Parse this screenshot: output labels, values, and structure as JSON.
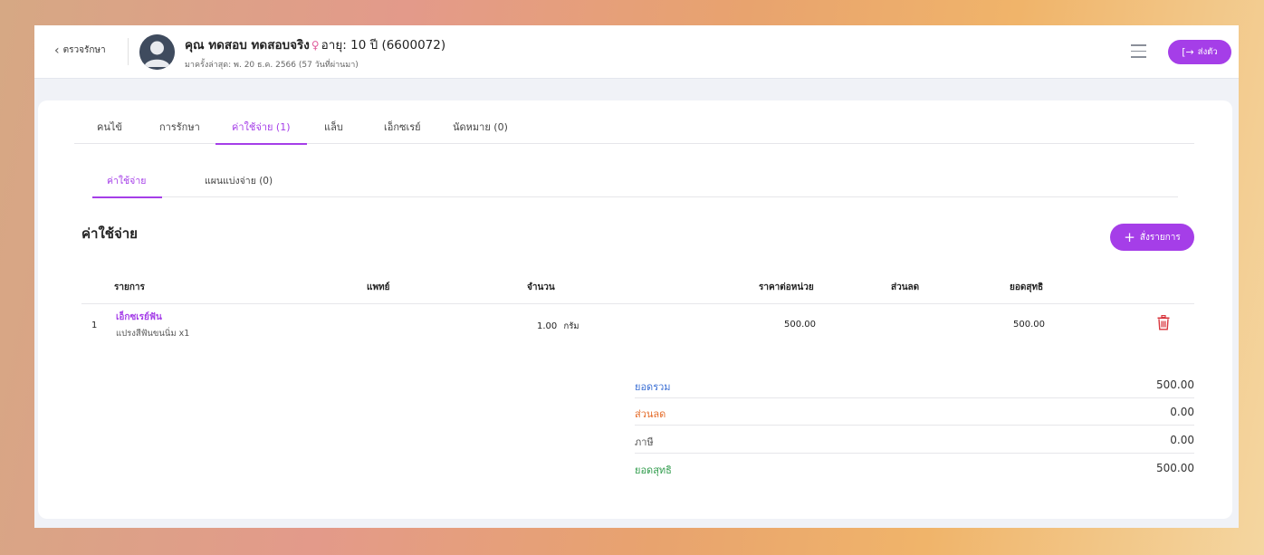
{
  "header": {
    "back_label": "ตรวจรักษา",
    "name": "คุณ ทดสอบ ทดสอบจริง",
    "gender_symbol": "♀",
    "age_text": "อายุ: 10 ปี (6600072)",
    "last_visit": "มาครั้งล่าสุด: พ. 20 ธ.ค. 2566 (57 วันที่ผ่านมา)",
    "checkout_label": "ส่งตัว",
    "checkout_icon": "[→"
  },
  "tabs": [
    {
      "label": "คนไข้"
    },
    {
      "label": "การรักษา"
    },
    {
      "label": "ค่าใช้จ่าย (1)"
    },
    {
      "label": "แล็บ"
    },
    {
      "label": "เอ็กซเรย์"
    },
    {
      "label": "นัดหมาย (0)"
    }
  ],
  "subtabs": [
    {
      "label": "ค่าใช้จ่าย"
    },
    {
      "label": "แผนแบ่งจ่าย (0)"
    }
  ],
  "section": {
    "title": "ค่าใช้จ่าย",
    "order_button": "สั่งรายการ"
  },
  "table": {
    "headers": {
      "item": "รายการ",
      "doctor": "แพทย์",
      "qty": "จำนวน",
      "unit_price": "ราคาต่อหน่วย",
      "discount": "ส่วนลด",
      "net": "ยอดสุทธิ"
    },
    "rows": [
      {
        "index": "1",
        "name": "เอ็กซเรย์ฟัน",
        "detail": "แปรงสีฟันขนนิ่ม x1",
        "doctor": "",
        "qty": "1.00",
        "unit": "กรัม",
        "unit_price": "500.00",
        "discount": "",
        "net": "500.00"
      }
    ]
  },
  "summary": {
    "total_label": "ยอดรวม",
    "total_value": "500.00",
    "discount_label": "ส่วนลด",
    "discount_value": "0.00",
    "tax_label": "ภาษี",
    "tax_value": "0.00",
    "net_label": "ยอดสุทธิ",
    "net_value": "500.00"
  },
  "colors": {
    "accent": "#a53ee8",
    "total": "#3b6fd4",
    "discount": "#e46a27",
    "net": "#2f9b4b",
    "delete": "#d9363e"
  }
}
